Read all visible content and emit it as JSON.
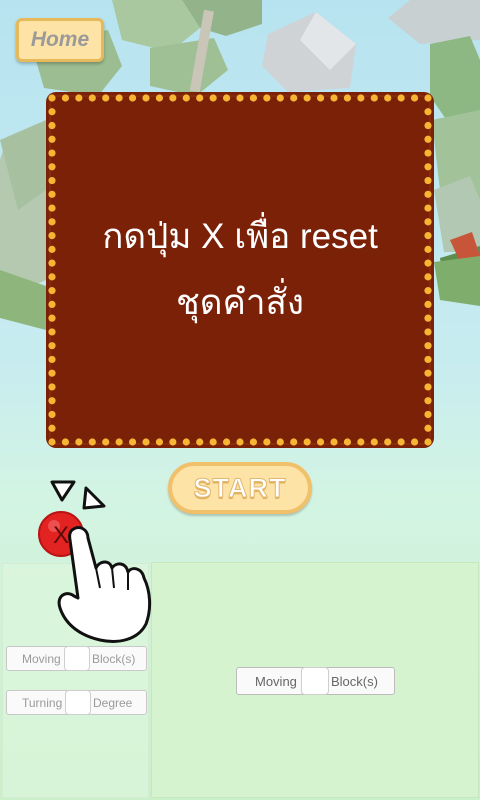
{
  "home": {
    "label": "Home"
  },
  "instruction": {
    "line1": "กดปุ่ม X เพื่อ reset",
    "line2": "ชุดคำสั่ง"
  },
  "start": {
    "label": "START"
  },
  "reset_button": {
    "label": "X"
  },
  "left_panel": {
    "moving": {
      "label_before": "Moving",
      "label_after": "Block(s)"
    },
    "turning": {
      "label_before": "Turning",
      "label_after": "Degree"
    }
  },
  "right_panel": {
    "moving": {
      "label_before": "Moving",
      "label_after": "Block(s)"
    }
  },
  "colors": {
    "board": "#7a2108",
    "board_dots": "#f7b534",
    "button_fill": "#fde3a6",
    "reset_red": "#e32222"
  }
}
